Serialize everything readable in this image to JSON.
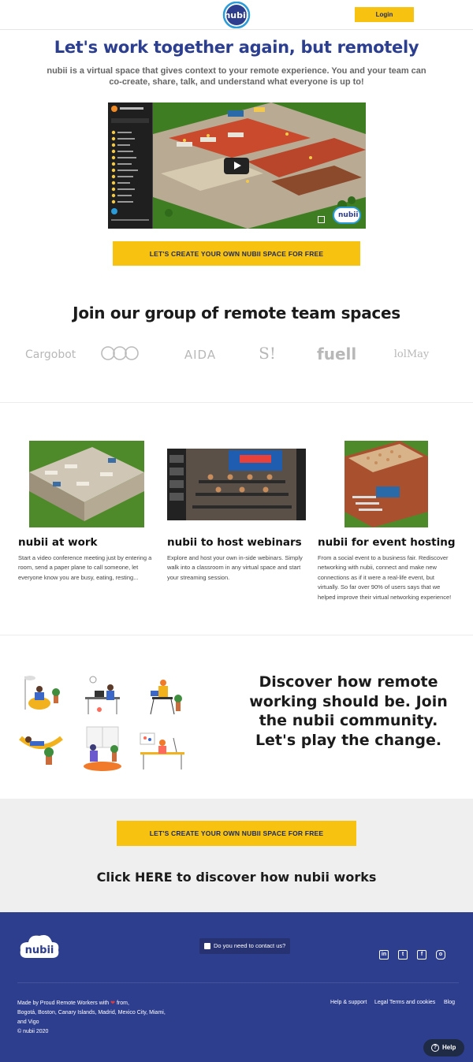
{
  "header": {
    "logo_text": "nubii",
    "login_label": "Login"
  },
  "hero": {
    "title": "Let's work together again, but remotely",
    "subtitle": "nubii is a virtual space that gives context to your remote experience. You and your team can co-create, share, talk, and understand what everyone is up to!",
    "video_watermark": "nubii"
  },
  "cta": {
    "primary_label": "LET'S CREATE YOUR OWN NUBII SPACE FOR FREE",
    "secondary_label": "LET'S CREATE YOUR OWN NUBII SPACE FOR FREE"
  },
  "partners": {
    "title": "Join our group of remote team spaces",
    "brands": [
      "Cargobot",
      "AIDA",
      "S!",
      "fuell",
      "lolMay"
    ]
  },
  "features": [
    {
      "title": "nubii at work",
      "text": "Start a video conference meeting just by entering a room, send a paper plane to call someone, let everyone know you are busy, eating, resting..."
    },
    {
      "title": "nubii to host webinars",
      "text": "Explore and host your own in-side webinars. Simply walk into a classroom in any virtual space and start your streaming session."
    },
    {
      "title": "nubii for event hosting",
      "text": "From a social event to a business fair. Rediscover networking with nubii, connect and make new connections as if it were a real-life event, but virtually. So far over 90% of users says that we helped improve their virtual networking experience!"
    }
  ],
  "community": {
    "text": "Discover how remote working should be. Join the nubii community. Let's play the change."
  },
  "discover_link": "Click HERE to discover how nubii works",
  "footer": {
    "logo_text": "nubii",
    "contact_label": "Do you need to contact us?",
    "social": [
      "linkedin",
      "twitter",
      "facebook",
      "instagram"
    ],
    "made_by_prefix": "Made by Proud Remote Workers with",
    "made_by_suffix": "from,",
    "cities": "Bogotá, Boston, Canary Islands, Madrid, Mexico City, Miami, and Vigo",
    "copyright": "© nubii 2020",
    "links": [
      "Help & support",
      "Legal Terms and cookies",
      "Blog"
    ]
  },
  "help_widget": {
    "label": "Help"
  },
  "colors": {
    "brand_blue": "#2c3e8f",
    "accent_yellow": "#f7c210",
    "footer_bg": "#2e3e8f"
  }
}
